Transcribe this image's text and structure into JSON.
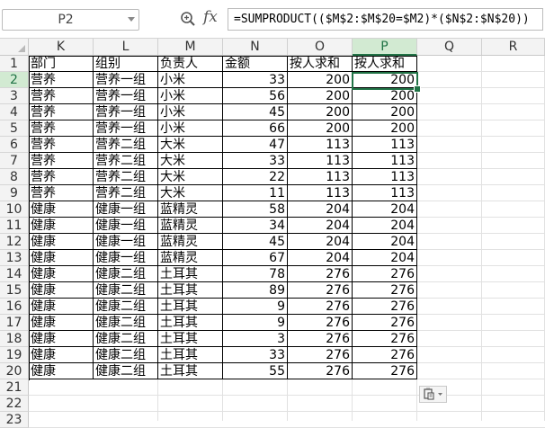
{
  "formula_bar": {
    "name_box": "P2",
    "fx_label": "fx",
    "formula": "=SUMPRODUCT(($M$2:$M$20=$M2)*($N$2:$N$20))"
  },
  "columns": [
    "K",
    "L",
    "M",
    "N",
    "O",
    "P",
    "Q",
    "R"
  ],
  "row_numbers": [
    "1",
    "2",
    "3",
    "4",
    "5",
    "6",
    "7",
    "8",
    "9",
    "10",
    "11",
    "12",
    "13",
    "14",
    "15",
    "16",
    "17",
    "18",
    "19",
    "20",
    "21",
    "22",
    "23"
  ],
  "selected_cell": "P2",
  "headers": [
    "部门",
    "组别",
    "负责人",
    "金额",
    "按人求和",
    "按人求和"
  ],
  "rows": [
    [
      "营养",
      "营养一组",
      "小米",
      "33",
      "200",
      "200"
    ],
    [
      "营养",
      "营养一组",
      "小米",
      "56",
      "200",
      "200"
    ],
    [
      "营养",
      "营养一组",
      "小米",
      "45",
      "200",
      "200"
    ],
    [
      "营养",
      "营养一组",
      "小米",
      "66",
      "200",
      "200"
    ],
    [
      "营养",
      "营养二组",
      "大米",
      "47",
      "113",
      "113"
    ],
    [
      "营养",
      "营养二组",
      "大米",
      "33",
      "113",
      "113"
    ],
    [
      "营养",
      "营养二组",
      "大米",
      "22",
      "113",
      "113"
    ],
    [
      "营养",
      "营养二组",
      "大米",
      "11",
      "113",
      "113"
    ],
    [
      "健康",
      "健康一组",
      "蓝精灵",
      "58",
      "204",
      "204"
    ],
    [
      "健康",
      "健康一组",
      "蓝精灵",
      "34",
      "204",
      "204"
    ],
    [
      "健康",
      "健康一组",
      "蓝精灵",
      "45",
      "204",
      "204"
    ],
    [
      "健康",
      "健康一组",
      "蓝精灵",
      "67",
      "204",
      "204"
    ],
    [
      "健康",
      "健康二组",
      "土耳其",
      "78",
      "276",
      "276"
    ],
    [
      "健康",
      "健康二组",
      "土耳其",
      "89",
      "276",
      "276"
    ],
    [
      "健康",
      "健康二组",
      "土耳其",
      "9",
      "276",
      "276"
    ],
    [
      "健康",
      "健康二组",
      "土耳其",
      "9",
      "276",
      "276"
    ],
    [
      "健康",
      "健康二组",
      "土耳其",
      "3",
      "276",
      "276"
    ],
    [
      "健康",
      "健康二组",
      "土耳其",
      "33",
      "276",
      "276"
    ],
    [
      "健康",
      "健康二组",
      "土耳其",
      "55",
      "276",
      "276"
    ]
  ],
  "icons": {
    "zoom": "zoom-icon",
    "dropdown": "chevron-down-icon",
    "paste_options": "paste-options-icon"
  },
  "colors": {
    "accent": "#217346",
    "selected_header_bg": "#d2ead2",
    "header_bg": "#f3f3f3"
  }
}
